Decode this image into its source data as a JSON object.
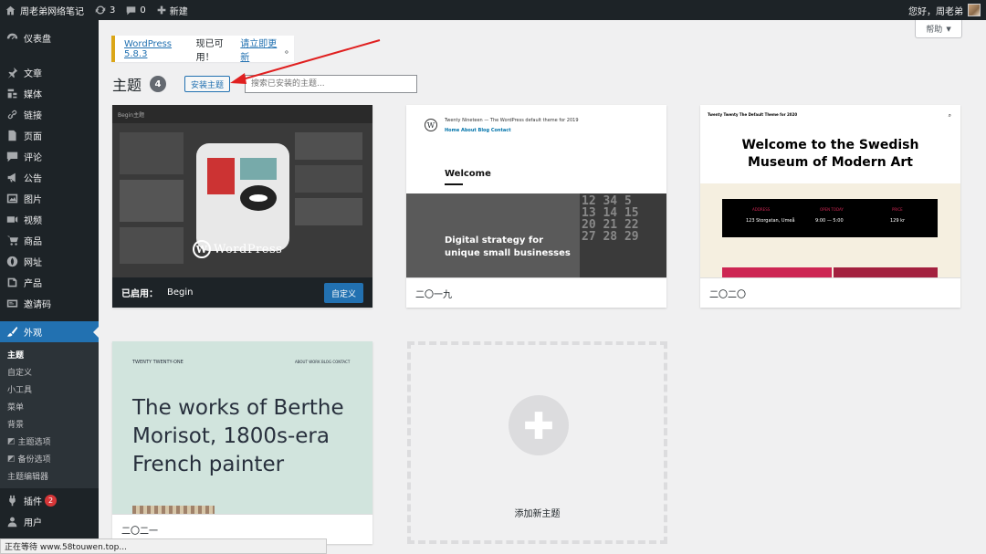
{
  "adminbar": {
    "site_name": "周老弟网络笔记",
    "updates_count": "3",
    "comments_count": "0",
    "new_label": "新建",
    "greeting": "您好，周老弟"
  },
  "sidebar": {
    "items": [
      {
        "label": "仪表盘",
        "icon": "dashboard-icon"
      },
      {
        "label": "文章",
        "icon": "pin-icon"
      },
      {
        "label": "媒体",
        "icon": "media-icon"
      },
      {
        "label": "链接",
        "icon": "link-icon"
      },
      {
        "label": "页面",
        "icon": "page-icon"
      },
      {
        "label": "评论",
        "icon": "comment-icon"
      },
      {
        "label": "公告",
        "icon": "megaphone-icon"
      },
      {
        "label": "图片",
        "icon": "image-icon"
      },
      {
        "label": "视频",
        "icon": "video-icon"
      },
      {
        "label": "商品",
        "icon": "cart-icon"
      },
      {
        "label": "网址",
        "icon": "globe-icon"
      },
      {
        "label": "产品",
        "icon": "product-icon"
      },
      {
        "label": "邀请码",
        "icon": "code-icon"
      }
    ],
    "appearance": {
      "label": "外观",
      "icon": "paintbrush-icon"
    },
    "submenu": [
      "主题",
      "自定义",
      "小工具",
      "菜单",
      "背景",
      "主题选项",
      "备份选项",
      "主题编辑器"
    ],
    "plugins": {
      "label": "插件",
      "badge": "2"
    },
    "users": {
      "label": "用户"
    }
  },
  "help_label": "帮助",
  "notice": {
    "version_link": "WordPress 5.8.3",
    "text": "现已可用！",
    "update_link": "请立即更新",
    "end": "。"
  },
  "page": {
    "title": "主题",
    "count": "4",
    "install_button": "安装主题",
    "search_placeholder": "搜索已安装的主题..."
  },
  "themes": {
    "begin": {
      "active_prefix": "已启用：",
      "name": "Begin",
      "customize": "自定义",
      "logo_text": "WordPress",
      "top_text": "Begin主题"
    },
    "t2019": {
      "name": "二〇一九",
      "head": "Twenty Nineteen — The WordPress default theme for 2019",
      "nav": "Home   About   Blog   Contact",
      "welcome": "Welcome",
      "line1": "Digital strategy for",
      "line2": "unique small businesses"
    },
    "t2020": {
      "name": "二〇二〇",
      "head": "Twenty Twenty   The Default Theme for 2020",
      "title1": "Welcome to the Swedish",
      "title2": "Museum of Modern Art",
      "col1": "ADDRESS",
      "col2": "OPEN TODAY",
      "col3": "PRICE",
      "val1": "123 Storgatan, Umeå",
      "val2": "9:00 — 5:00",
      "val3": "129 kr"
    },
    "t2021": {
      "name": "二〇二一",
      "small": "TWENTY TWENTY-ONE",
      "nav": "ABOUT   WORK   BLOG   CONTACT",
      "line1": "The works of Berthe",
      "line2": "Morisot, 1800s-era",
      "line3": "French painter"
    },
    "add_new": "添加新主题"
  },
  "status_text": "正在等待 www.58touwen.top..."
}
